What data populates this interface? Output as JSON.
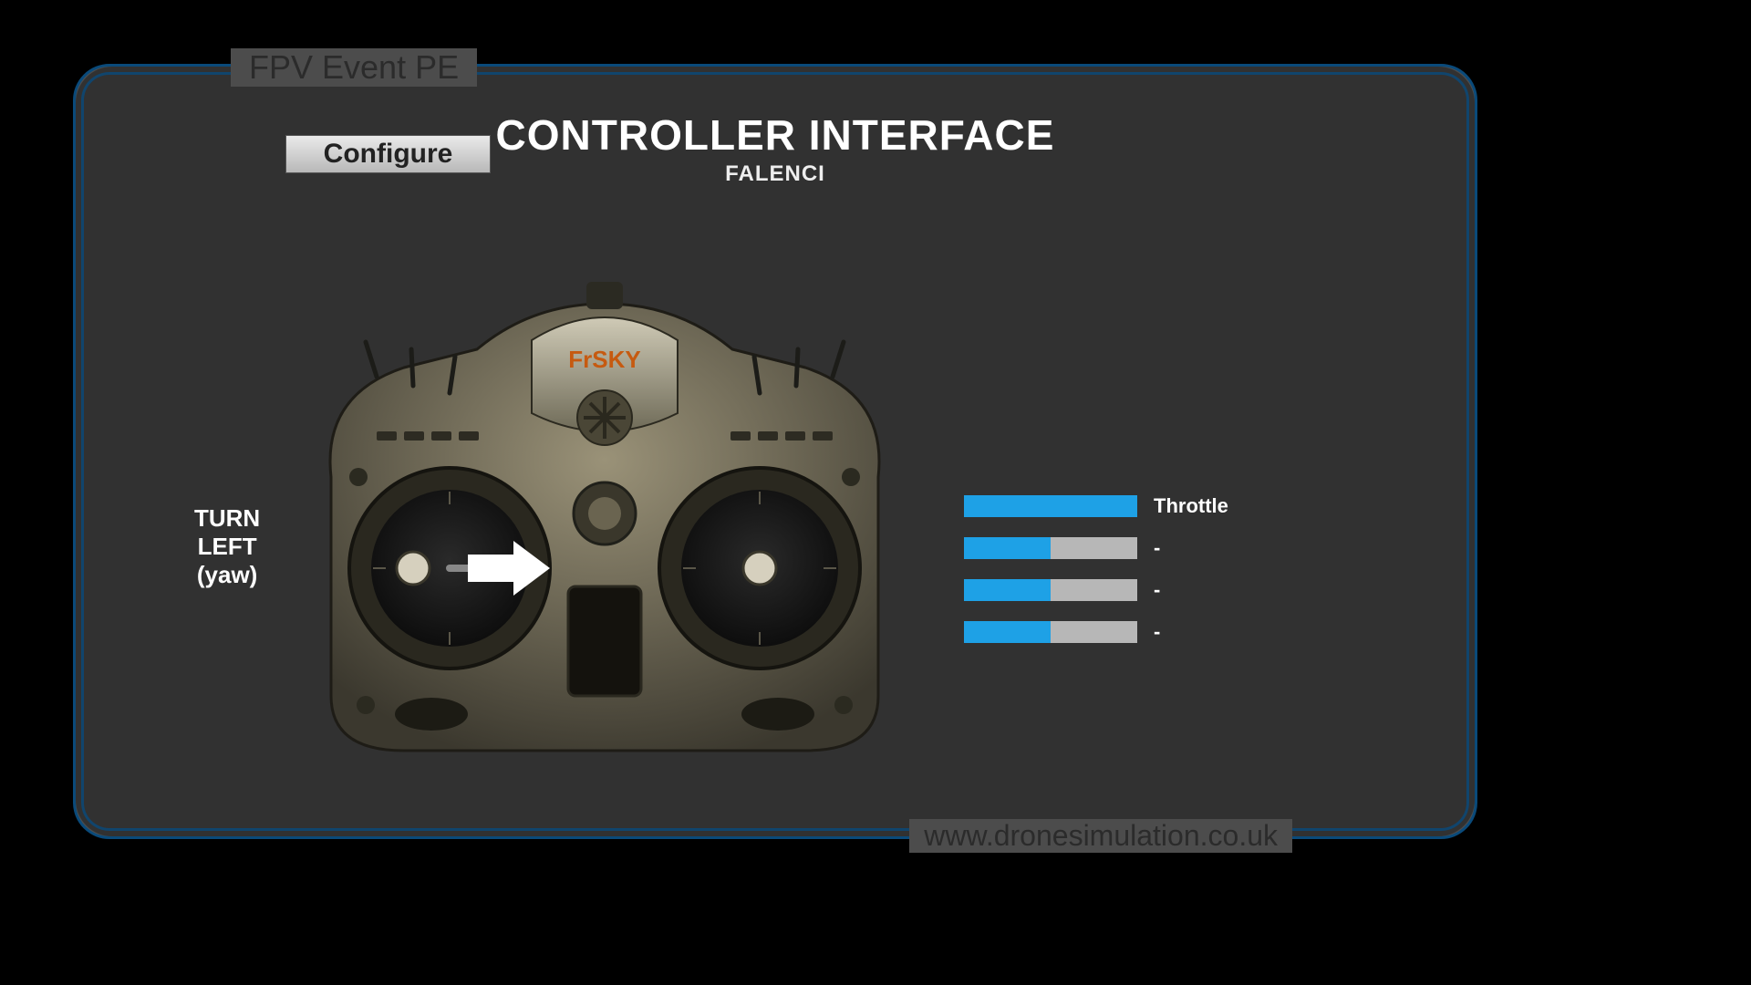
{
  "panel": {
    "title": "FPV Event PE",
    "configure_label": "Configure",
    "heading": "CONTROLLER INTERFACE",
    "subheading": "FALENCI",
    "hint": "TURN\nLEFT\n(yaw)",
    "footer": "www.dronesimulation.co.uk",
    "transmitter_brand": "FrSKY"
  },
  "gauges": [
    {
      "label": "Throttle",
      "fill_pct": 100
    },
    {
      "label": "-",
      "fill_pct": 50
    },
    {
      "label": "-",
      "fill_pct": 50
    },
    {
      "label": "-",
      "fill_pct": 50
    }
  ],
  "colors": {
    "accent_blue": "#1ea1e6",
    "panel_bg": "#4c4c4c",
    "border_blue": "#1a6aa8"
  }
}
